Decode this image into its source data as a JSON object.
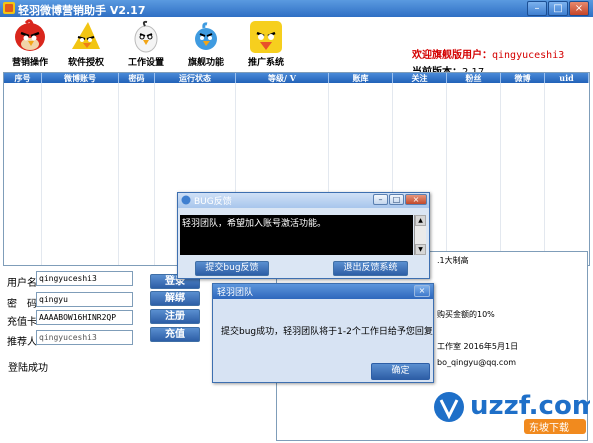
{
  "window": {
    "title": "轻羽微博营销助手 V2.17",
    "minimize": "–",
    "maximize": "□",
    "close": "×"
  },
  "toolbar": {
    "tools": [
      {
        "label": "营销操作",
        "icon": "red-angry-bird-icon",
        "color": "#d9261c"
      },
      {
        "label": "软件授权",
        "icon": "yellow-angry-bird-icon",
        "color": "#f2c513"
      },
      {
        "label": "工作设置",
        "icon": "white-angry-bird-icon",
        "color": "#f4f4f4"
      },
      {
        "label": "旗舰功能",
        "icon": "blue-angry-bird-icon",
        "color": "#3f9be0"
      },
      {
        "label": "推广系统",
        "icon": "yellow-bird-tile-icon",
        "color": "#f6cf1e"
      }
    ],
    "welcome_prefix": "欢迎旗舰版用户：",
    "welcome_user": "qingyuceshi3",
    "version_prefix": "当前版本：",
    "version_value": "2.17"
  },
  "grid": {
    "columns": [
      "序号",
      "微博账号",
      "密码",
      "运行状态",
      "等级/ V",
      "账库",
      "关注",
      "粉丝",
      "微博",
      "uid"
    ]
  },
  "form": {
    "username_label": "用户名:",
    "username_value": "qingyuceshi3",
    "password_label": "密　码:",
    "password_value": "qingyu",
    "card_label": "充值卡:",
    "card_value": "AAAABOW16HINR2QP",
    "referrer_label": "推荐人:",
    "referrer_value": "qingyuceshi3",
    "buttons": [
      "登录",
      "解绑",
      "注册",
      "充值"
    ],
    "status": "登陆成功"
  },
  "info_panel": {
    "lines": [
      ".1大制高",
      "购买金额的10%",
      "工作室 2016年5月1日",
      "bo_qingyu@qq.com"
    ]
  },
  "bug_dialog": {
    "title": "BUG反馈",
    "content": "轻羽团队，希望加入账号激活功能。",
    "submit_label": "提交bug反馈",
    "exit_label": "退出反馈系统",
    "min": "–",
    "max": "□",
    "close": "×"
  },
  "success_dialog": {
    "title": "轻羽团队",
    "message": "提交bug成功，轻羽团队将于1-2个工作日给予您回复",
    "ok_label": "确定",
    "close": "×"
  },
  "watermark": {
    "brand": "uzzf.com",
    "subtitle": "东坡下载",
    "colors": {
      "main": "#1e6fc8",
      "accent": "#f18a1e"
    }
  }
}
